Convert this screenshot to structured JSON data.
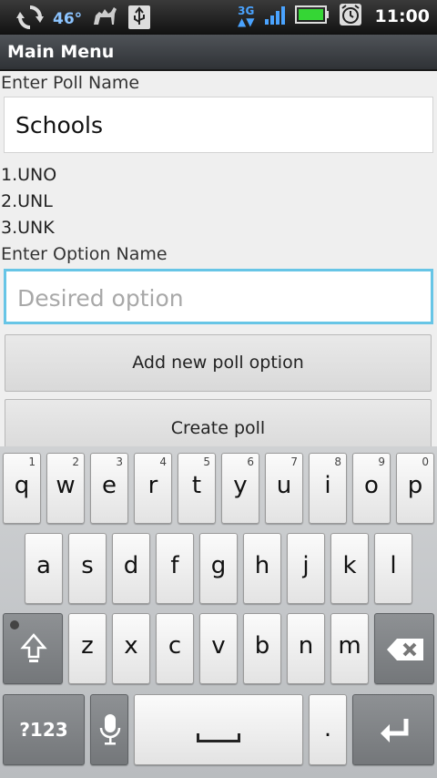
{
  "status_bar": {
    "temperature": "46°",
    "network": "3G",
    "time": "11:00",
    "icons": [
      "sync-icon",
      "weather-camel-icon",
      "usb-icon",
      "network-3g-icon",
      "signal-icon",
      "battery-icon",
      "alarm-icon"
    ]
  },
  "title_bar": {
    "title": "Main Menu"
  },
  "form": {
    "poll_name_label": "Enter Poll Name",
    "poll_name_value": "Schools",
    "options": [
      "1.UNO",
      "2.UNL",
      "3.UNK"
    ],
    "option_name_label": "Enter Option Name",
    "option_placeholder": "Desired option",
    "add_button": "Add new poll option",
    "create_button": "Create poll"
  },
  "keyboard": {
    "row1": [
      {
        "key": "q",
        "num": "1"
      },
      {
        "key": "w",
        "num": "2"
      },
      {
        "key": "e",
        "num": "3"
      },
      {
        "key": "r",
        "num": "4"
      },
      {
        "key": "t",
        "num": "5"
      },
      {
        "key": "y",
        "num": "6"
      },
      {
        "key": "u",
        "num": "7"
      },
      {
        "key": "i",
        "num": "8"
      },
      {
        "key": "o",
        "num": "9"
      },
      {
        "key": "p",
        "num": "0"
      }
    ],
    "row2": [
      "a",
      "s",
      "d",
      "f",
      "g",
      "h",
      "j",
      "k",
      "l"
    ],
    "row3": [
      "z",
      "x",
      "c",
      "v",
      "b",
      "n",
      "m"
    ],
    "symbols_key": "?123",
    "period_key": "."
  },
  "colors": {
    "focus_border": "#67c5e6",
    "title_bar": "#3f4347",
    "battery": "#35d635"
  }
}
